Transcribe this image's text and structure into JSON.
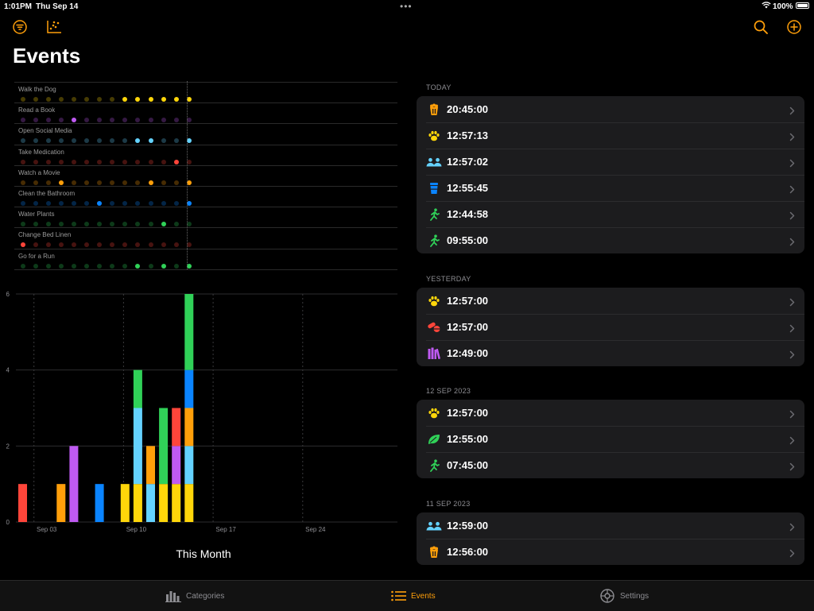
{
  "status_bar": {
    "time": "1:01PM",
    "date": "Thu Sep 14",
    "battery": "100%"
  },
  "colors": {
    "accent": "#ff9f0a",
    "yellow": "#ffd60a",
    "purple": "#bf5af2",
    "cyan": "#64d2ff",
    "red": "#ff453a",
    "orange": "#ff9f0a",
    "blue": "#0a84ff",
    "green": "#30d158"
  },
  "toolbar": {
    "left_icons": [
      "filter-icon",
      "scatter-chart-icon"
    ],
    "right_icons": [
      "search-icon",
      "add-icon"
    ]
  },
  "page": {
    "title": "Events"
  },
  "dot_matrix": {
    "rows": [
      {
        "label": "Walk the Dog",
        "color": "yellow",
        "active": [
          8,
          9,
          10,
          11,
          12,
          13
        ]
      },
      {
        "label": "Read a Book",
        "color": "purple",
        "active": [
          4
        ]
      },
      {
        "label": "Open Social Media",
        "color": "cyan",
        "active": [
          9,
          10,
          13
        ]
      },
      {
        "label": "Take Medication",
        "color": "red",
        "active": [
          12
        ]
      },
      {
        "label": "Watch a Movie",
        "color": "orange",
        "active": [
          3,
          10,
          13
        ]
      },
      {
        "label": "Clean the Bathroom",
        "color": "blue",
        "active": [
          6,
          13
        ]
      },
      {
        "label": "Water Plants",
        "color": "green",
        "active": [
          11
        ]
      },
      {
        "label": "Change Bed Linen",
        "color": "red",
        "active": [
          0
        ]
      },
      {
        "label": "Go for a Run",
        "color": "green",
        "active": [
          9,
          11,
          13
        ]
      }
    ]
  },
  "chart_data": {
    "type": "bar",
    "stacked": true,
    "x": [
      "Sep 01",
      "Sep 02",
      "Sep 03",
      "Sep 04",
      "Sep 05",
      "Sep 06",
      "Sep 07",
      "Sep 08",
      "Sep 09",
      "Sep 10",
      "Sep 11",
      "Sep 12",
      "Sep 13",
      "Sep 14"
    ],
    "x_ticks": [
      "Sep 03",
      "Sep 10",
      "Sep 17",
      "Sep 24"
    ],
    "y_ticks": [
      0,
      2,
      4,
      6
    ],
    "ylim": [
      0,
      6
    ],
    "grid": true,
    "series": [
      {
        "color": "yellow",
        "values": [
          0,
          0,
          0,
          0,
          0,
          0,
          0,
          0,
          1,
          1,
          0,
          1,
          1,
          1
        ]
      },
      {
        "color": "purple",
        "values": [
          0,
          0,
          0,
          0,
          2,
          0,
          0,
          0,
          0,
          0,
          0,
          0,
          1,
          0
        ]
      },
      {
        "color": "cyan",
        "values": [
          0,
          0,
          0,
          0,
          0,
          0,
          0,
          0,
          0,
          2,
          1,
          0,
          0,
          1
        ]
      },
      {
        "color": "red",
        "values": [
          1,
          0,
          0,
          0,
          0,
          0,
          0,
          0,
          0,
          0,
          0,
          0,
          1,
          0
        ]
      },
      {
        "color": "orange",
        "values": [
          0,
          0,
          0,
          1,
          0,
          0,
          0,
          0,
          0,
          0,
          1,
          0,
          0,
          1
        ]
      },
      {
        "color": "blue",
        "values": [
          0,
          0,
          0,
          0,
          0,
          0,
          1,
          0,
          0,
          0,
          0,
          0,
          0,
          1
        ]
      },
      {
        "color": "green",
        "values": [
          0,
          0,
          0,
          0,
          0,
          0,
          0,
          0,
          0,
          1,
          0,
          2,
          0,
          2
        ]
      }
    ],
    "caption": "This Month"
  },
  "sections": [
    {
      "header": "TODAY",
      "events": [
        {
          "time": "20:45:00",
          "icon": "popcorn-icon",
          "color": "orange"
        },
        {
          "time": "12:57:13",
          "icon": "paw-icon",
          "color": "yellow"
        },
        {
          "time": "12:57:02",
          "icon": "people-icon",
          "color": "cyan"
        },
        {
          "time": "12:55:45",
          "icon": "cup-icon",
          "color": "blue"
        },
        {
          "time": "12:44:58",
          "icon": "runner-icon",
          "color": "green"
        },
        {
          "time": "09:55:00",
          "icon": "runner-icon",
          "color": "green"
        }
      ]
    },
    {
      "header": "YESTERDAY",
      "events": [
        {
          "time": "12:57:00",
          "icon": "paw-icon",
          "color": "yellow"
        },
        {
          "time": "12:57:00",
          "icon": "pills-icon",
          "color": "red"
        },
        {
          "time": "12:49:00",
          "icon": "books-icon",
          "color": "purple"
        }
      ]
    },
    {
      "header": "12 SEP 2023",
      "events": [
        {
          "time": "12:57:00",
          "icon": "paw-icon",
          "color": "yellow"
        },
        {
          "time": "12:55:00",
          "icon": "leaf-icon",
          "color": "green"
        },
        {
          "time": "07:45:00",
          "icon": "runner-icon",
          "color": "green"
        }
      ]
    },
    {
      "header": "11 SEP 2023",
      "events": [
        {
          "time": "12:59:00",
          "icon": "people-icon",
          "color": "cyan"
        },
        {
          "time": "12:56:00",
          "icon": "popcorn-icon",
          "color": "orange"
        }
      ]
    }
  ],
  "tab_bar": {
    "tabs": [
      {
        "label": "Categories",
        "icon": "bar-chart-icon",
        "active": false
      },
      {
        "label": "Events",
        "icon": "list-icon",
        "active": true
      },
      {
        "label": "Settings",
        "icon": "gear-icon",
        "active": false
      }
    ]
  }
}
